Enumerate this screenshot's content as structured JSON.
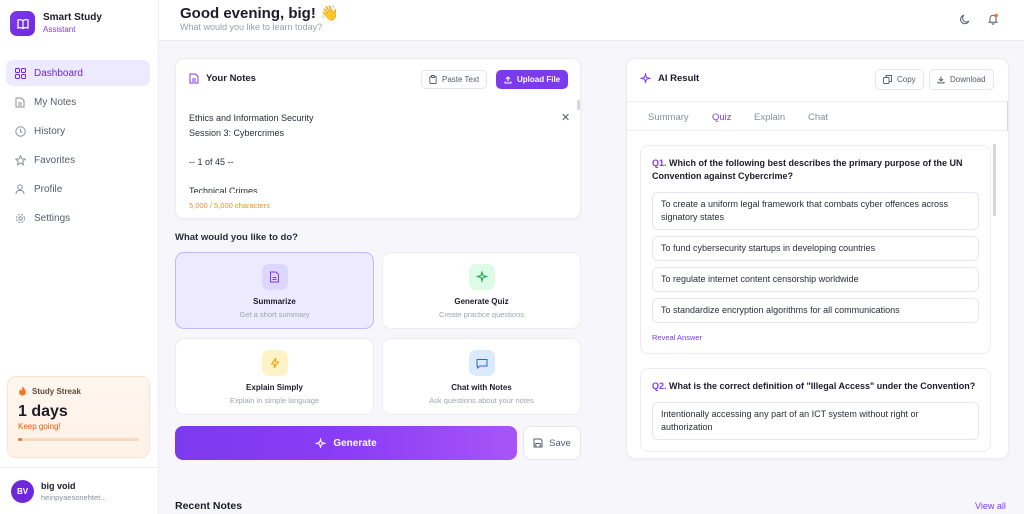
{
  "brand": {
    "title": "Smart Study",
    "subtitle": "Assistant"
  },
  "nav": [
    {
      "label": "Dashboard",
      "icon": "grid-icon",
      "active": true
    },
    {
      "label": "My Notes",
      "icon": "document-icon"
    },
    {
      "label": "History",
      "icon": "clock-icon"
    },
    {
      "label": "Favorites",
      "icon": "star-icon"
    },
    {
      "label": "Profile",
      "icon": "user-icon"
    },
    {
      "label": "Settings",
      "icon": "gear-icon"
    }
  ],
  "streak": {
    "title": "Study Streak",
    "days": "1 days",
    "message": "Keep going!",
    "progress": 0.03
  },
  "user": {
    "initials": "BV",
    "name": "big void",
    "email": "heinpyaesonehtet..."
  },
  "header": {
    "greeting": "Good evening, big! 👋",
    "subtitle": "What would you like to learn today?"
  },
  "notes": {
    "title": "Your Notes",
    "paste_label": "Paste Text",
    "upload_label": "Upload File",
    "content": "Ethics and Information Security\nSession 3: Cybercrimes\n\n-- 1 of 45 --\n\nTechnical Crimes",
    "char_count": "5,000 / 5,000 characters"
  },
  "actions": {
    "question": "What would you like to do?",
    "options": [
      {
        "title": "Summarize",
        "desc": "Get a short summary",
        "selected": true
      },
      {
        "title": "Generate Quiz",
        "desc": "Create practice questions"
      },
      {
        "title": "Explain Simply",
        "desc": "Explain in simple language"
      },
      {
        "title": "Chat with Notes",
        "desc": "Ask questions about your notes"
      }
    ],
    "generate_label": "Generate",
    "save_label": "Save"
  },
  "recent": {
    "title": "Recent Notes",
    "view_all": "View all"
  },
  "ai": {
    "title": "AI Result",
    "copy_label": "Copy",
    "download_label": "Download",
    "tabs": [
      "Summary",
      "Quiz",
      "Explain",
      "Chat"
    ],
    "active_tab": "Quiz",
    "questions": [
      {
        "num": "Q1.",
        "text": "Which of the following best describes the primary purpose of the UN Convention against Cybercrime?",
        "answers": [
          "To create a uniform legal framework that combats cyber offences across signatory states",
          "To fund cybersecurity startups in developing countries",
          "To regulate internet content censorship worldwide",
          "To standardize encryption algorithms for all communications"
        ],
        "reveal": "Reveal Answer"
      },
      {
        "num": "Q2.",
        "text": "What is the correct definition of \"Illegal Access\" under the Convention?",
        "answers": [
          "Intentionally accessing any part of an ICT system without right or authorization"
        ]
      }
    ]
  },
  "colors": {
    "accent": "#7c3aed",
    "streak": "#f97316"
  }
}
